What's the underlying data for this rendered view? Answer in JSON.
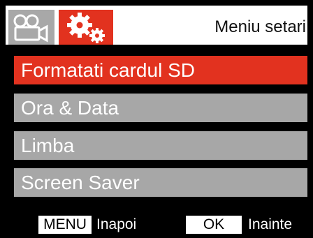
{
  "header": {
    "title": "Meniu setari",
    "tabs": [
      {
        "icon": "video-camera-icon",
        "active": false,
        "color": "#a8a8a8"
      },
      {
        "icon": "gears-icon",
        "active": true,
        "color": "#e2321f"
      }
    ]
  },
  "menu": {
    "items": [
      {
        "label": "Formatati cardul SD",
        "selected": true
      },
      {
        "label": "Ora & Data",
        "selected": false
      },
      {
        "label": "Limba",
        "selected": false
      },
      {
        "label": "Screen Saver",
        "selected": false
      }
    ],
    "selected_color": "#e2321f",
    "item_color": "#a7a7a7"
  },
  "footer": {
    "menu_key": "MENU",
    "menu_action": "Inapoi",
    "ok_key": "OK",
    "ok_action": "Inainte"
  }
}
